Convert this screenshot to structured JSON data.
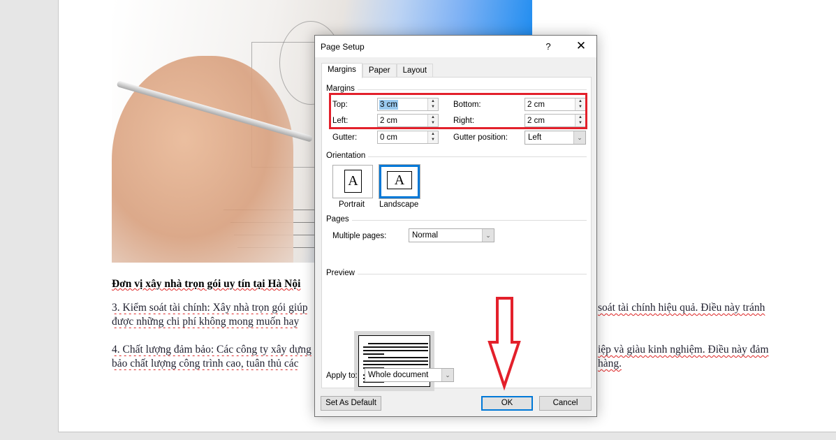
{
  "document": {
    "heading": "Đơn vị xây nhà trọn gói uy tín tại Hà Nội",
    "paragraphs": [
      {
        "line1_left": "3. Kiểm soát tài chính: Xây nhà trọn gói giúp",
        "line1_right": "soát tài chính hiệu quả. Điều này tránh",
        "line2_left": "được những chi phí không mong muốn hay"
      },
      {
        "line1_left": "4. Chất lượng đảm bảo: Các công ty xây dựng",
        "line1_right": "iệp và giàu kinh nghiệm. Điều này đảm",
        "line2_left": "bảo chất lượng công trình cao, tuân thủ các",
        "line2_right": "hàng."
      }
    ]
  },
  "dialog": {
    "title": "Page Setup",
    "help_label": "?",
    "close_label": "✕",
    "tabs": [
      {
        "label": "Margins",
        "active": true
      },
      {
        "label": "Paper",
        "active": false
      },
      {
        "label": "Layout",
        "active": false
      }
    ],
    "margins": {
      "section_label": "Margins",
      "top": {
        "label": "Top:",
        "value": "3 cm"
      },
      "bottom": {
        "label": "Bottom:",
        "value": "2 cm"
      },
      "left": {
        "label": "Left:",
        "value": "2 cm"
      },
      "right": {
        "label": "Right:",
        "value": "2 cm"
      },
      "gutter": {
        "label": "Gutter:",
        "value": "0 cm"
      },
      "gutter_position": {
        "label": "Gutter position:",
        "value": "Left"
      }
    },
    "orientation": {
      "section_label": "Orientation",
      "portrait_label": "Portrait",
      "landscape_label": "Landscape",
      "selected": "Landscape",
      "glyph": "A"
    },
    "pages": {
      "section_label": "Pages",
      "multiple_pages_label": "Multiple pages:",
      "multiple_pages_value": "Normal"
    },
    "preview": {
      "section_label": "Preview",
      "apply_to_label": "Apply to:",
      "apply_to_value": "Whole document"
    },
    "buttons": {
      "set_default": "Set As Default",
      "ok": "OK",
      "cancel": "Cancel"
    }
  },
  "annotations": {
    "highlight_color": "#e3202b",
    "accent_color": "#0078d7"
  }
}
